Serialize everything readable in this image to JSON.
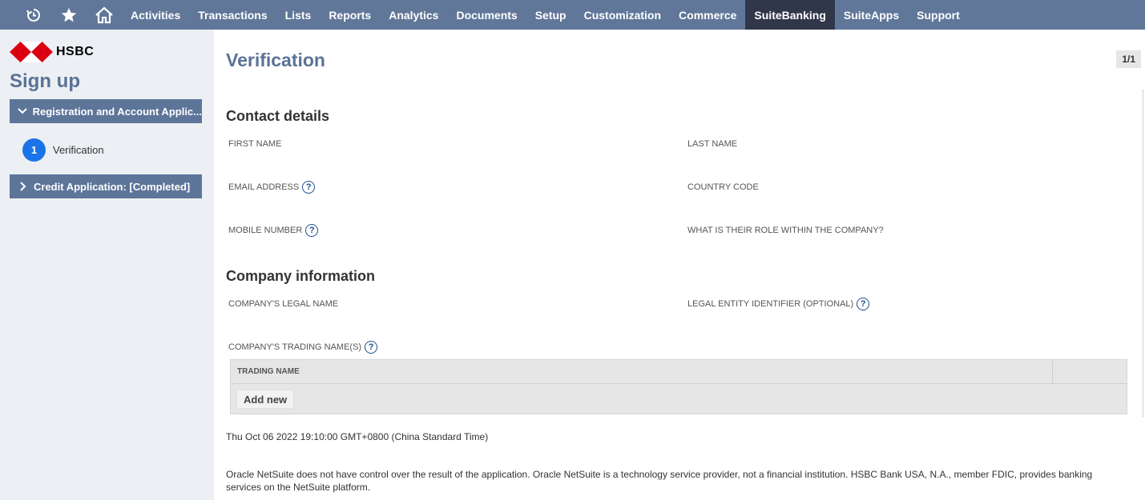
{
  "nav": {
    "icons": [
      "recent-icon",
      "star-icon",
      "home-icon"
    ],
    "items": [
      "Activities",
      "Transactions",
      "Lists",
      "Reports",
      "Analytics",
      "Documents",
      "Setup",
      "Customization",
      "Commerce",
      "SuiteBanking",
      "SuiteApps",
      "Support"
    ],
    "active": "SuiteBanking"
  },
  "sidebar": {
    "logo_text": "HSBC",
    "title": "Sign up",
    "sections": [
      {
        "label": "Registration and Account Applic...",
        "expanded": true
      },
      {
        "label": "Credit Application: [Completed]",
        "expanded": false
      }
    ],
    "step": {
      "number": "1",
      "label": "Verification"
    }
  },
  "main": {
    "title": "Verification",
    "page_count": "1/1",
    "contact": {
      "title": "Contact details",
      "first_name": "FIRST NAME",
      "last_name": "LAST NAME",
      "email": "EMAIL ADDRESS",
      "country_code": "COUNTRY CODE",
      "mobile": "MOBILE NUMBER",
      "role": "WHAT IS THEIR ROLE WITHIN THE COMPANY?"
    },
    "company": {
      "title": "Company information",
      "legal_name": "COMPANY'S LEGAL NAME",
      "lei": "LEGAL ENTITY IDENTIFIER (OPTIONAL)",
      "trading_names": "COMPANY'S TRADING NAME(S)",
      "table_header": "TRADING NAME",
      "add_new": "Add new"
    },
    "timestamp": "Thu Oct 06 2022 19:10:00 GMT+0800 (China Standard Time)",
    "disclaimer": "Oracle NetSuite does not have control over the result of the application. Oracle NetSuite is a technology service provider, not a financial institution. HSBC Bank USA, N.A., member FDIC, provides banking services on the NetSuite platform."
  },
  "colors": {
    "nav_bg": "#607799",
    "nav_active": "#30374a",
    "accent": "#5a7296",
    "step_blue": "#1a73e8",
    "hsbc_red": "#db0011"
  }
}
